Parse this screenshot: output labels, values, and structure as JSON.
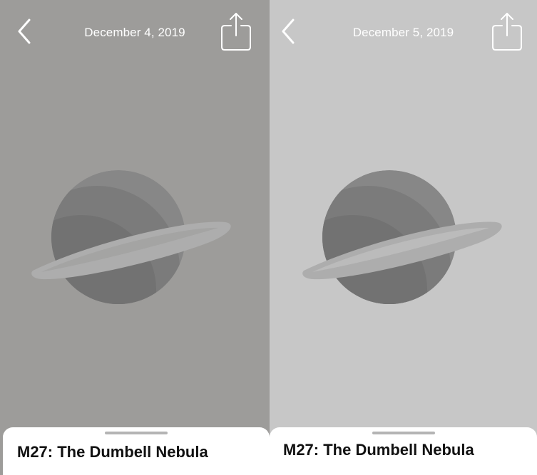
{
  "colors": {
    "left_background": "#9d9c9a",
    "right_background": "#c7c7c7",
    "nav_foreground": "#ffffff",
    "planet_body": "#7b7b7b",
    "planet_shadow": "#6f6f6f",
    "planet_light": "#878787",
    "ring": "#adadad",
    "sheet": "#ffffff",
    "title_text": "#111111"
  },
  "panels": [
    {
      "date": "December 4, 2019",
      "back_icon": "chevron-left-icon",
      "share_icon": "share-icon",
      "hero_icon": "planet-icon",
      "title": "M27: The Dumbell Nebula"
    },
    {
      "date": "December 5, 2019",
      "back_icon": "chevron-left-icon",
      "share_icon": "share-icon",
      "hero_icon": "planet-icon",
      "title": "M27: The Dumbell Nebula"
    }
  ]
}
